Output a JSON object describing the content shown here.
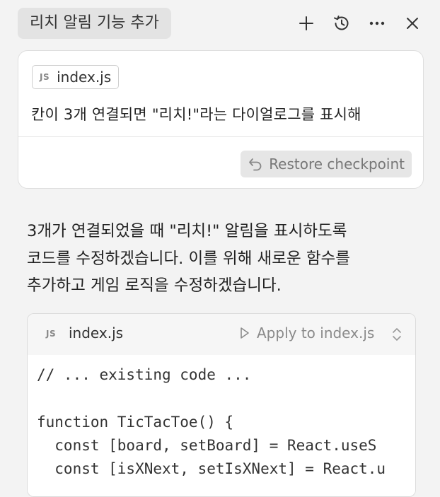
{
  "header": {
    "title": "리치 알림 기능 추가",
    "icons": [
      "plus-icon",
      "history-icon",
      "more-icon",
      "close-icon"
    ]
  },
  "message": {
    "file_chip": {
      "badge": "JS",
      "name": "index.js"
    },
    "text": "칸이 3개 연결되면 \"리치!\"라는 다이얼로그를 표시해",
    "restore_label": "Restore checkpoint"
  },
  "response": {
    "lines": [
      "3개가 연결되었을 때 \"리치!\" 알림을 표시하도록",
      "코드를 수정하겠습니다. 이를 위해 새로운 함수를",
      "추가하고 게임 로직을 수정하겠습니다."
    ]
  },
  "code_block": {
    "badge": "JS",
    "filename": "index.js",
    "apply_label": "Apply to index.js",
    "lines": [
      "// ... existing code ...",
      "",
      "function TicTacToe() {",
      "  const [board, setBoard] = React.useS",
      "  const [isXNext, setIsXNext] = React.u"
    ]
  },
  "colors": {
    "background": "#f3f3f3",
    "card": "#ffffff",
    "pill": "#e3e3e3",
    "muted_text": "#777777"
  }
}
